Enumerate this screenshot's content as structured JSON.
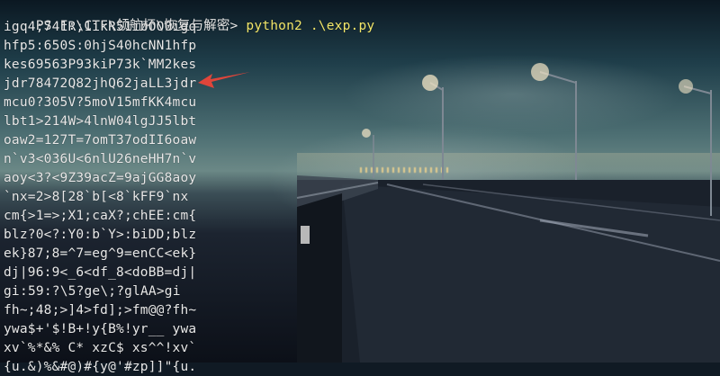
{
  "window": {
    "prompt": "PS F:\\CTF\\领航杯\\恢复与解密> ",
    "command": "python2 .\\exp.py"
  },
  "output_lines": [
    "igq4;741R;1ikR51ibOO0igq",
    "hfp5:650S:0hjS40hcNN1hfp",
    "kes69563P93kiP73k`MM2kes",
    "jdr78472Q82jhQ62jaLL3jdr",
    "mcu0?305V?5moV15mfKK4mcu",
    "lbt1>214W>4lnW04lgJJ5lbt",
    "oaw2=127T=7omT37odII6oaw",
    "n`v3<036U<6nlU26neHH7n`v",
    "aoy<3?<9Z39acZ=9ajGG8aoy",
    "`nx=2>8[28`b[<8`kFF9`nx",
    "cm{>1=>;X1;caX?;chEE:cm{",
    "blz?0<?:Y0:b`Y>:biDD;blz",
    "ek}87;8=^7=eg^9=enCC<ek}",
    "dj|96:9<_6<df_8<doBB=dj|",
    "gi:59:?\\5?ge\\;?glAA>gi",
    "fh~;48;>]4>fd];>fm@@?fh~",
    "ywa$+'$!B+!y{B%!yr__ ywa",
    "xv`%*&% C* xzC$ xs^^!xv`",
    "{u.&)%&#@)#{y@'#zp]]\"{u."
  ],
  "colors": {
    "text": "#e8e8e8",
    "command": "#f2e66a",
    "arrow": "#e0453a",
    "cursor": "#b8b8b8"
  },
  "annotation": {
    "type": "red-arrow-icon",
    "target_line_index": 3
  }
}
